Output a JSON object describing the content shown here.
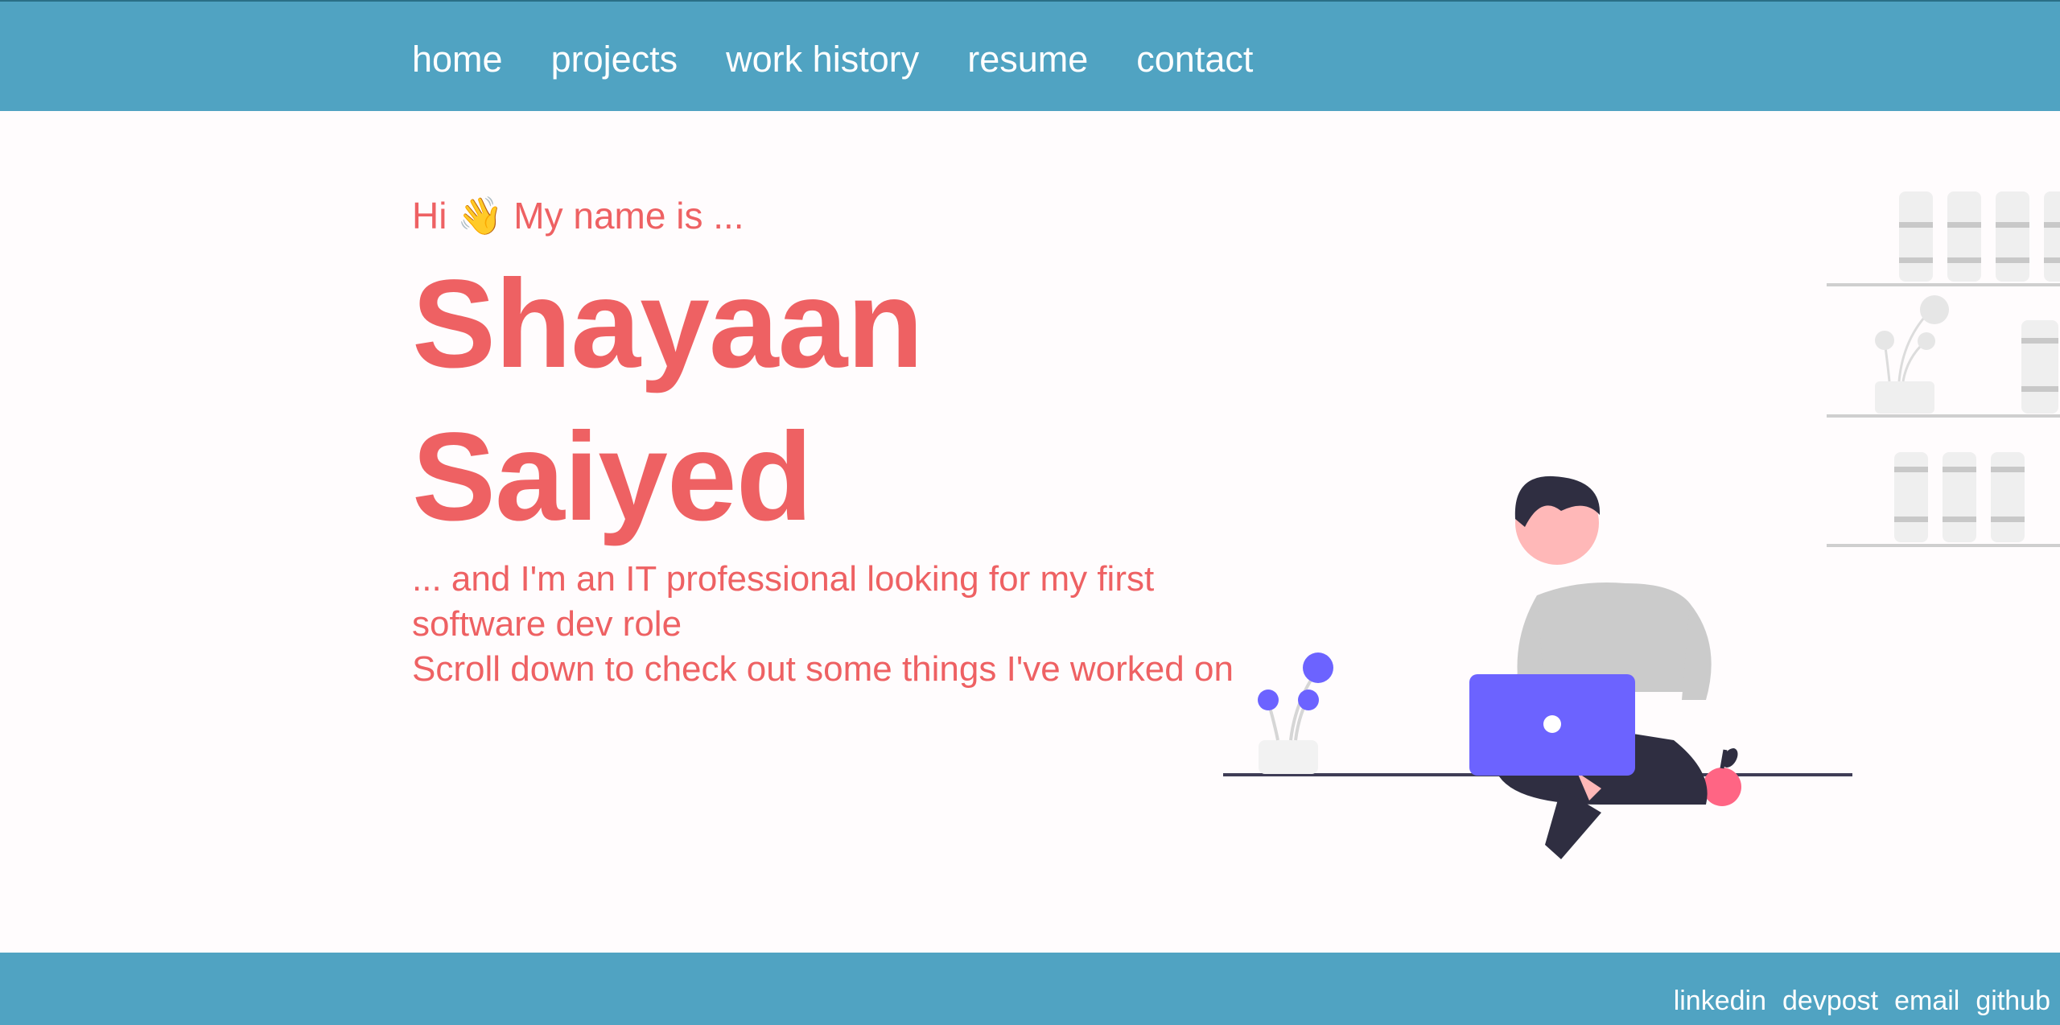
{
  "nav": {
    "items": [
      {
        "label": "home"
      },
      {
        "label": "projects"
      },
      {
        "label": "work history"
      },
      {
        "label": "resume"
      },
      {
        "label": "contact"
      }
    ]
  },
  "hero": {
    "greeting": "Hi 👋 My name is ...",
    "first_name": "Shayaan",
    "last_name": "Saiyed",
    "tagline": "... and I'm an IT professional looking for my first software dev role",
    "cta": "Scroll down to check out some things I've worked on"
  },
  "footer": {
    "links": [
      {
        "label": "linkedin"
      },
      {
        "label": "devpost"
      },
      {
        "label": "email"
      },
      {
        "label": "github"
      }
    ]
  },
  "colors": {
    "header_bg": "#50a3c2",
    "accent_text": "#ee6163",
    "laptop": "#6c63ff",
    "page_bg": "#fffcfd"
  }
}
